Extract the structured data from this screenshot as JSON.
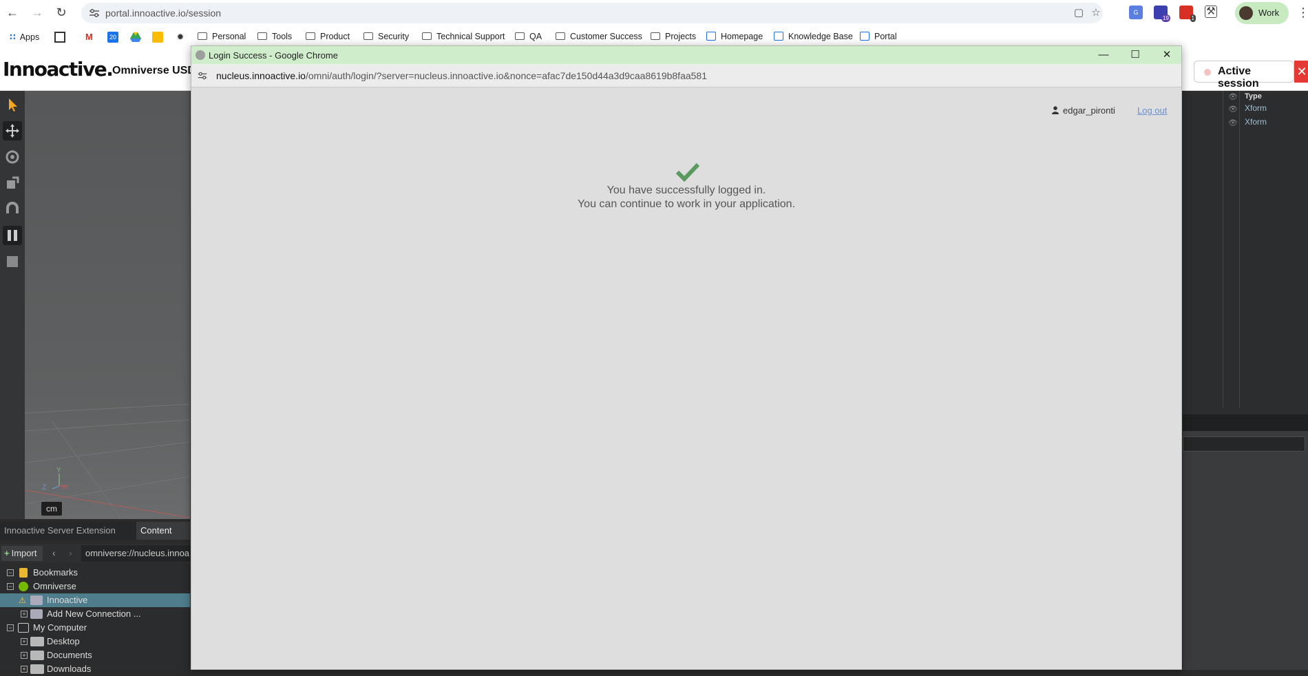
{
  "browser": {
    "url": "portal.innoactive.io/session",
    "profile_label": "Work",
    "ext_badge_1": "19",
    "ext_badge_2": "1",
    "gcal_day": "20"
  },
  "bookmarks": {
    "apps": "Apps",
    "items": [
      "Personal",
      "Tools",
      "Product",
      "Security",
      "Technical Support",
      "QA",
      "Customer Success",
      "Projects"
    ],
    "links": [
      "Homepage",
      "Knowledge Base",
      "Portal"
    ]
  },
  "portal": {
    "logo": "Innoactive.",
    "app_title": "Omniverse USD C",
    "active_session": "Active session",
    "close_session": "✕"
  },
  "omniverse": {
    "units": "cm",
    "axis_z": "Z",
    "axis_x": "X",
    "axis_y": "Y",
    "right_panel": {
      "type_header": "Type",
      "rows": [
        "Xform",
        "Xform"
      ]
    },
    "bottom_tabs": [
      "Innoactive Server Extension",
      "Content"
    ],
    "import_label": "Import",
    "path": "omniverse://nucleus.innoa",
    "tree": [
      "Bookmarks",
      "Omniverse",
      "Innoactive",
      "Add New Connection ...",
      "My Computer",
      "Desktop",
      "Documents",
      "Downloads"
    ]
  },
  "popup": {
    "title": "Login Success - Google Chrome",
    "url_host": "nucleus.innoactive.io",
    "url_rest": "/omni/auth/login/?server=nucleus.innoactive.io&nonce=afac7de150d44a3d9caa8619b8faa581",
    "username": "edgar_pironti",
    "logout": "Log out",
    "message_line1": "You have successfully logged in.",
    "message_line2": "You can continue to work in your application.",
    "check_color": "#5a9a5e"
  }
}
